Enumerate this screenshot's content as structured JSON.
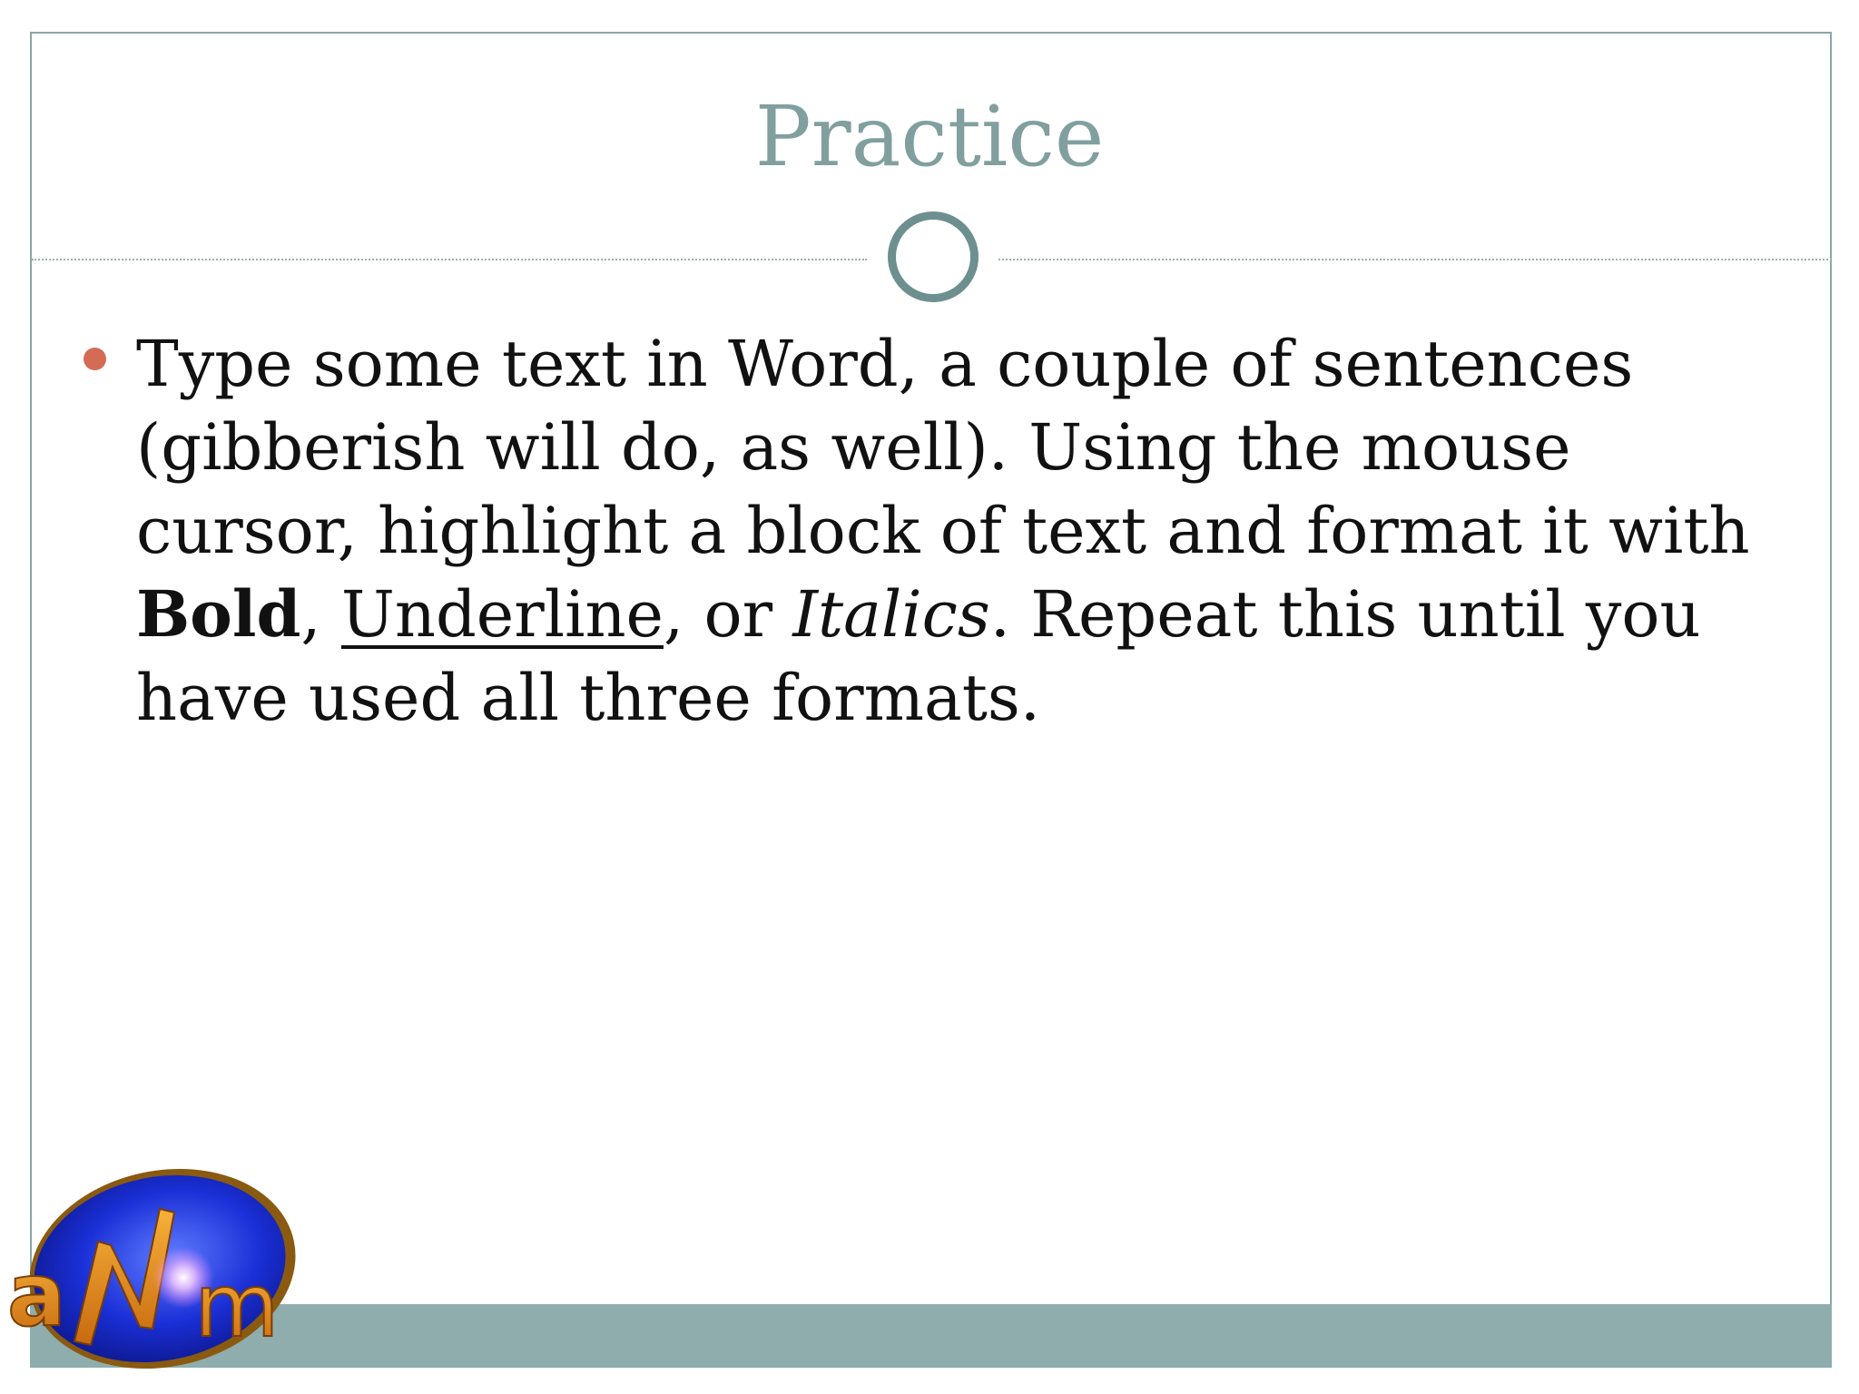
{
  "slide": {
    "title": "Practice",
    "bullets": [
      {
        "parts": [
          {
            "text": "Type some text in Word, a couple of sentences (gibberish will do, as well). Using the mouse cursor, highlight a block of text and format it with ",
            "style": "normal"
          },
          {
            "text": "Bold",
            "style": "bold"
          },
          {
            "text": ", ",
            "style": "normal"
          },
          {
            "text": "Underline",
            "style": "underline"
          },
          {
            "text": ", or ",
            "style": "normal"
          },
          {
            "text": "Italics",
            "style": "italic"
          },
          {
            "text": ". Repeat this until you have used all three formats.",
            "style": "normal"
          }
        ]
      }
    ]
  },
  "logo": {
    "text": "aNm",
    "icon": "anm-logo-icon"
  },
  "colors": {
    "title": "#819f9f",
    "ring": "#6d8f8f",
    "bullet": "#d46b55",
    "footer_bar": "#8fadad",
    "frame_border": "#8aa6a6",
    "logo_blue": "#1a2fd6",
    "logo_orange": "#e8901c"
  }
}
